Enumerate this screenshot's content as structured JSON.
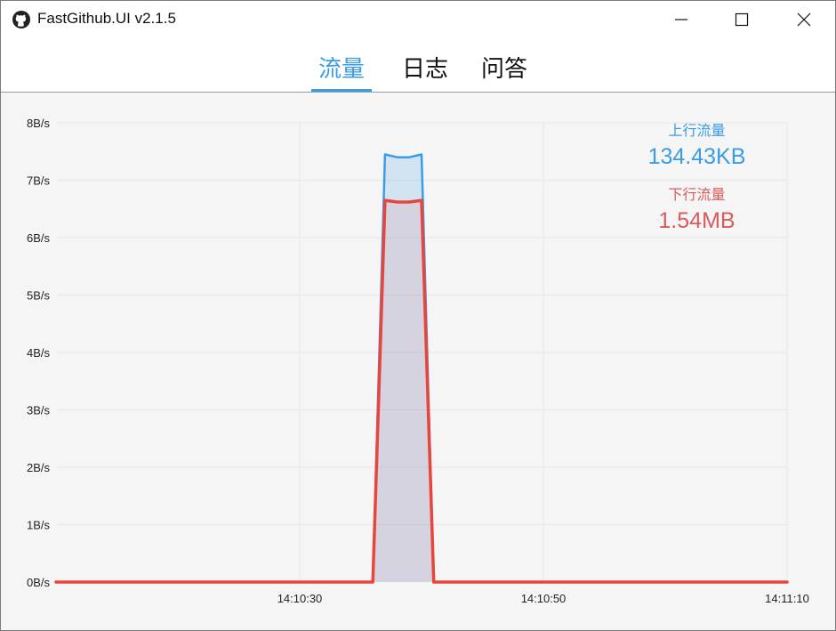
{
  "window": {
    "title": "FastGithub.UI v2.1.5"
  },
  "tabs": [
    {
      "label": "流量",
      "active": true
    },
    {
      "label": "日志",
      "active": false
    },
    {
      "label": "问答",
      "active": false
    }
  ],
  "stats": {
    "upload_label": "上行流量",
    "upload_value": "134.43KB",
    "download_label": "下行流量",
    "download_value": "1.54MB"
  },
  "colors": {
    "accent": "#3a9be7",
    "upload": "#3a9be7",
    "download": "#e8453c"
  },
  "chart_data": {
    "type": "area",
    "title": "",
    "xlabel": "",
    "ylabel": "",
    "y_ticks": [
      "0B/s",
      "1B/s",
      "2B/s",
      "3B/s",
      "4B/s",
      "5B/s",
      "6B/s",
      "7B/s",
      "8B/s"
    ],
    "ylim": [
      0,
      8
    ],
    "x_ticks": [
      "14:10:30",
      "14:10:50",
      "14:11:10"
    ],
    "xlim": [
      "14:10:10",
      "14:11:10"
    ],
    "grid": true,
    "series": [
      {
        "name": "上行流量",
        "x": [
          "14:10:10",
          "14:10:35",
          "14:10:36",
          "14:10:37",
          "14:10:38",
          "14:10:39",
          "14:10:40",
          "14:10:41",
          "14:10:42",
          "14:11:10"
        ],
        "values": [
          0,
          0,
          0,
          7.45,
          7.4,
          7.4,
          7.45,
          0,
          0,
          0
        ]
      },
      {
        "name": "下行流量",
        "x": [
          "14:10:10",
          "14:10:35",
          "14:10:36",
          "14:10:37",
          "14:10:38",
          "14:10:39",
          "14:10:40",
          "14:10:41",
          "14:10:42",
          "14:11:10"
        ],
        "values": [
          0,
          0,
          0,
          6.65,
          6.62,
          6.62,
          6.65,
          0,
          0,
          0
        ]
      }
    ]
  }
}
